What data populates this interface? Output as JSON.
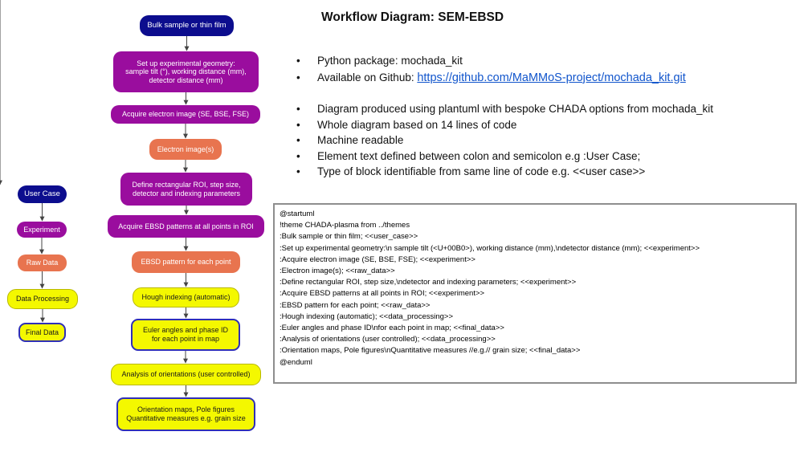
{
  "title": "Workflow Diagram: SEM-EBSD",
  "legend": [
    {
      "type": "user_case",
      "label": "User Case"
    },
    {
      "type": "experiment",
      "label": "Experiment"
    },
    {
      "type": "raw_data",
      "label": "Raw Data"
    },
    {
      "type": "data_processing",
      "label": "Data Processing"
    },
    {
      "type": "final_data",
      "label": "Final Data"
    }
  ],
  "flow": [
    {
      "type": "user_case",
      "label": "Bulk sample or thin film"
    },
    {
      "type": "experiment",
      "label": "Set up experimental geometry:\nsample tilt (°), working distance (mm),\ndetector distance (mm)"
    },
    {
      "type": "experiment",
      "label": "Acquire electron image (SE, BSE, FSE)"
    },
    {
      "type": "raw_data",
      "label": "Electron image(s)"
    },
    {
      "type": "experiment",
      "label": "Define rectangular ROI, step size,\ndetector and indexing parameters"
    },
    {
      "type": "experiment",
      "label": "Acquire EBSD patterns at all points in ROI"
    },
    {
      "type": "raw_data",
      "label": "EBSD pattern for each point"
    },
    {
      "type": "data_processing",
      "label": "Hough indexing (automatic)"
    },
    {
      "type": "final_data",
      "label": "Euler angles and phase ID\nfor each point in map"
    },
    {
      "type": "data_processing",
      "label": "Analysis of orientations (user controlled)"
    },
    {
      "type": "final_data",
      "label": "Orientation maps, Pole figures\nQuantitative measures  e.g. grain size"
    }
  ],
  "bullet_symbol": "•",
  "bullets_group1": [
    {
      "text": "Python package: mochada_kit",
      "link": ""
    },
    {
      "text": "Available on Github:  ",
      "link": "https://github.com/MaMMoS-project/mochada_kit.git"
    }
  ],
  "bullets_group2": [
    "Diagram produced using plantuml with bespoke CHADA options from mochada_kit",
    "Whole diagram based on 14 lines of code",
    "Machine readable",
    "Element text defined between colon and semicolon e.g :User Case;",
    "Type of block identifiable from same line of code e.g. <<user case>>"
  ],
  "code_lines": [
    "@startuml",
    "!theme CHADA-plasma from ../themes",
    ":Bulk sample or thin film; <<user_case>>",
    ":Set up experimental geometry:\\n sample tilt (<U+00B0>), working distance (mm),\\ndetector distance (mm); <<experiment>>",
    ":Acquire electron image (SE, BSE, FSE); <<experiment>>",
    ":Electron image(s); <<raw_data>>",
    ":Define rectangular ROI, step size,\\ndetector and indexing parameters; <<experiment>>",
    ":Acquire EBSD patterns at all points in ROI; <<experiment>>",
    ":EBSD pattern for each point; <<raw_data>>",
    ":Hough indexing (automatic); <<data_processing>>",
    ":Euler angles and phase ID\\nfor each point in map; <<final_data>>",
    ":Analysis of orientations (user controlled); <<data_processing>>",
    ":Orientation maps, Pole figures\\nQuantitative measures //e.g.// grain size; <<final_data>>",
    "@enduml"
  ],
  "colors": {
    "user_case": "#0c0d8e",
    "experiment": "#9a0d9e",
    "raw_data": "#e8744f",
    "data_processing": "#f4f800",
    "final_data_border": "#2f2fb7",
    "link": "#1155cc"
  }
}
